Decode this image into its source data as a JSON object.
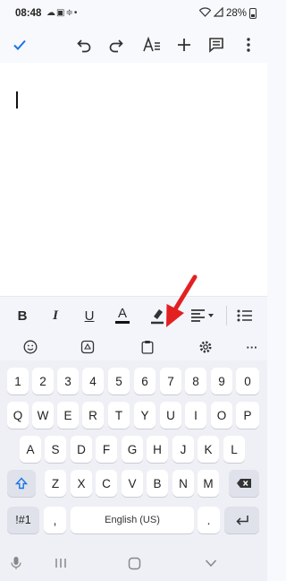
{
  "status_bar": {
    "time": "08:48",
    "notification_icons": [
      "cloud-icon",
      "image-icon",
      "drive-icon",
      "dot-icon"
    ],
    "battery_percent": "28%"
  },
  "toolbar": {
    "icons": [
      "check-icon",
      "undo-icon",
      "redo-icon",
      "text-format-icon",
      "add-icon",
      "comment-icon",
      "more-vert-icon"
    ]
  },
  "document": {
    "content": ""
  },
  "format_bar": {
    "bold": "B",
    "italic": "I",
    "underline": "U",
    "text_color": "A",
    "icons": [
      "bold-icon",
      "italic-icon",
      "underline-icon",
      "text-color-icon",
      "highlight-icon",
      "align-left-icon",
      "bulleted-list-icon"
    ]
  },
  "keyboard_toolbar": {
    "icons": [
      "emoji-icon",
      "sticker-icon",
      "clipboard-icon",
      "settings-icon"
    ],
    "more": "···"
  },
  "keyboard": {
    "row_numbers": [
      "1",
      "2",
      "3",
      "4",
      "5",
      "6",
      "7",
      "8",
      "9",
      "0"
    ],
    "row_1": [
      "Q",
      "W",
      "E",
      "R",
      "T",
      "Y",
      "U",
      "I",
      "O",
      "P"
    ],
    "row_2": [
      "A",
      "S",
      "D",
      "F",
      "G",
      "H",
      "J",
      "K",
      "L"
    ],
    "row_3": [
      "Z",
      "X",
      "C",
      "V",
      "B",
      "N",
      "M"
    ],
    "symbols_key": "!#1",
    "comma_key": ",",
    "space_key": "English (US)",
    "period_key": "."
  },
  "colors": {
    "accent": "#1a73e8",
    "arrow": "#e32020",
    "keyboard_bg": "#eef0f5",
    "key_bg": "#ffffff"
  }
}
